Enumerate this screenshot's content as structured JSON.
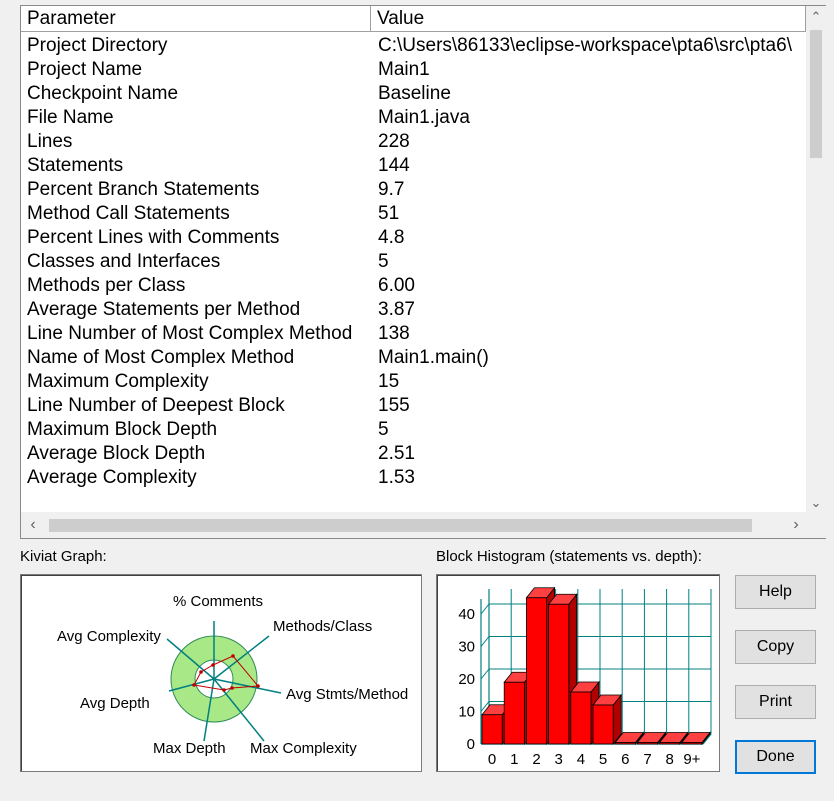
{
  "table": {
    "columns": [
      "Parameter",
      "Value"
    ],
    "rows": [
      [
        "Project Directory",
        "C:\\Users\\86133\\eclipse-workspace\\pta6\\src\\pta6\\"
      ],
      [
        "Project Name",
        "Main1"
      ],
      [
        "Checkpoint Name",
        "Baseline"
      ],
      [
        "File Name",
        "Main1.java"
      ],
      [
        "Lines",
        "228"
      ],
      [
        "Statements",
        "144"
      ],
      [
        "Percent Branch Statements",
        "9.7"
      ],
      [
        "Method Call Statements",
        "51"
      ],
      [
        "Percent Lines with Comments",
        "4.8"
      ],
      [
        "Classes and Interfaces",
        "5"
      ],
      [
        "Methods per Class",
        "6.00"
      ],
      [
        "Average Statements per Method",
        "3.87"
      ],
      [
        "Line Number of Most Complex Method",
        "138"
      ],
      [
        "Name of Most Complex Method",
        "Main1.main()"
      ],
      [
        "Maximum Complexity",
        "15"
      ],
      [
        "Line Number of Deepest Block",
        "155"
      ],
      [
        "Maximum Block Depth",
        "5"
      ],
      [
        "Average Block Depth",
        "2.51"
      ],
      [
        "Average Complexity",
        "1.53"
      ]
    ]
  },
  "scrollbars": {
    "vertical_up_icon": "chevron-up-icon",
    "vertical_down_icon": "chevron-down-icon",
    "horizontal_left_icon": "chevron-left-icon",
    "horizontal_right_icon": "chevron-right-icon"
  },
  "kiviat": {
    "label": "Kiviat Graph:",
    "axes": [
      "% Comments",
      "Methods/Class",
      "Avg Stmts/Method",
      "Max Complexity",
      "Max Depth",
      "Avg Depth",
      "Avg Complexity"
    ],
    "colors": {
      "ring": "#a8e886",
      "ring_stroke": "#2e8b57",
      "axis": "#008080",
      "polygon": "#c00000"
    }
  },
  "histogram": {
    "label": "Block Histogram (statements vs. depth):"
  },
  "chart_data": {
    "type": "bar",
    "categories": [
      "0",
      "1",
      "2",
      "3",
      "4",
      "5",
      "6",
      "7",
      "8",
      "9+"
    ],
    "values": [
      9,
      19,
      45,
      43,
      16,
      12,
      0,
      0,
      0,
      0
    ],
    "ylim": [
      0,
      45
    ],
    "yticks": [
      0,
      10,
      20,
      30,
      40
    ],
    "grid": true,
    "bar_color": "#ff0000",
    "grid_color": "#008080"
  },
  "buttons": {
    "help": "Help",
    "copy": "Copy",
    "print": "Print",
    "done": "Done"
  }
}
